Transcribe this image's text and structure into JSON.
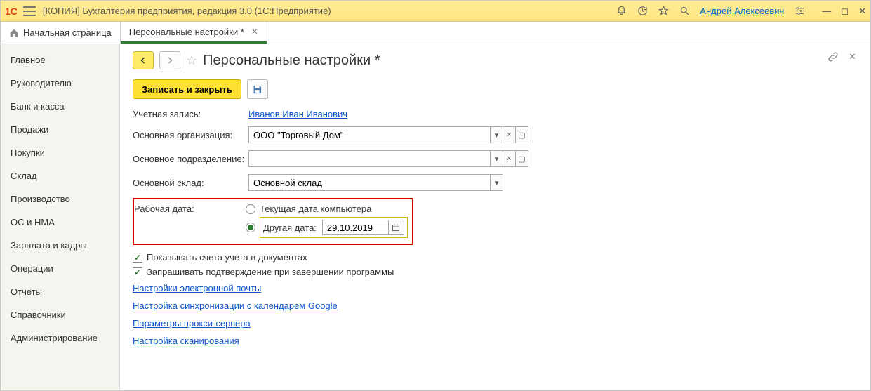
{
  "titlebar": {
    "title": "[КОПИЯ] Бухгалтерия предприятия, редакция 3.0  (1С:Предприятие)",
    "user": "Андрей Алексеевич"
  },
  "tabs": {
    "home": "Начальная страница",
    "active": "Персональные настройки *"
  },
  "sidebar": {
    "items": [
      "Главное",
      "Руководителю",
      "Банк и касса",
      "Продажи",
      "Покупки",
      "Склад",
      "Производство",
      "ОС и НМА",
      "Зарплата и кадры",
      "Операции",
      "Отчеты",
      "Справочники",
      "Администрирование"
    ]
  },
  "page": {
    "title": "Персональные настройки *",
    "save_close": "Записать и закрыть"
  },
  "form": {
    "account_label": "Учетная запись:",
    "account_value": "Иванов Иван Иванович",
    "org_label": "Основная организация:",
    "org_value": "ООО \"Торговый Дом\"",
    "dept_label": "Основное подразделение:",
    "dept_value": "",
    "wh_label": "Основной склад:",
    "wh_value": "Основной склад",
    "workdate_label": "Рабочая дата:",
    "radio_current": "Текущая дата компьютера",
    "radio_other": "Другая дата:",
    "date_value": "29.10.2019",
    "show_accounts": "Показывать счета учета в документах",
    "confirm_exit": "Запрашивать подтверждение при завершении программы",
    "links": {
      "email": "Настройки электронной почты",
      "google": "Настройка синхронизации с календарем Google",
      "proxy": "Параметры прокси-сервера",
      "scanner": "Настройка сканирования"
    }
  }
}
